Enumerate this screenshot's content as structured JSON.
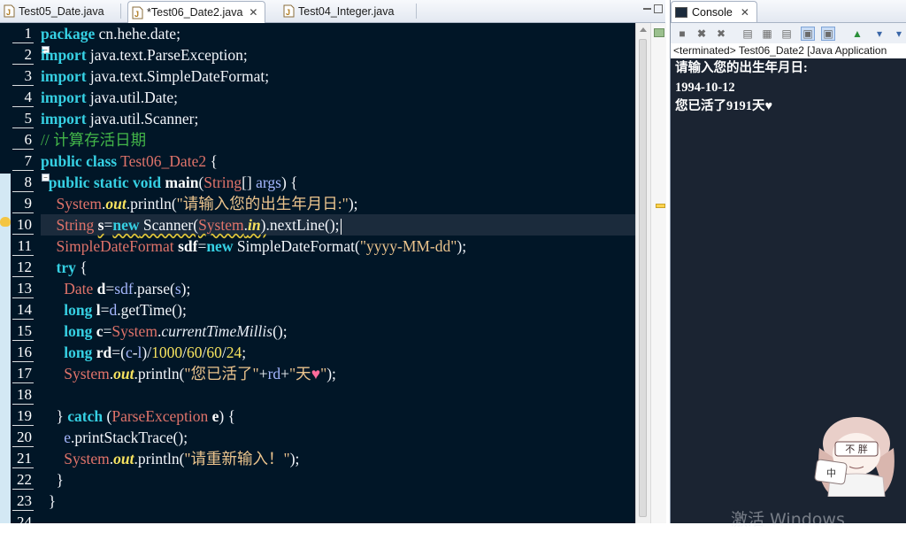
{
  "editor": {
    "tabs": [
      {
        "label": "Test05_Date.java",
        "active": false,
        "closable": false
      },
      {
        "label": "*Test06_Date2.java",
        "active": true,
        "closable": true,
        "close_glyph": "✕"
      },
      {
        "label": "Test04_Integer.java",
        "active": false,
        "closable": false
      }
    ],
    "line_numbers": [
      "1",
      "2",
      "3",
      "4",
      "5",
      "6",
      "7",
      "8",
      "9",
      "10",
      "11",
      "12",
      "13",
      "14",
      "15",
      "16",
      "17",
      "18",
      "19",
      "20",
      "21",
      "22",
      "23",
      "24"
    ],
    "code_lines": [
      [
        {
          "t": "package",
          "c": "kw"
        },
        {
          "t": " cn.hehe.date;",
          "c": "pl"
        }
      ],
      [
        {
          "t": "import",
          "c": "kw"
        },
        {
          "t": " java.text.ParseException;",
          "c": "pl"
        }
      ],
      [
        {
          "t": "import",
          "c": "kw"
        },
        {
          "t": " java.text.SimpleDateFormat;",
          "c": "pl"
        }
      ],
      [
        {
          "t": "import",
          "c": "kw"
        },
        {
          "t": " java.util.Date;",
          "c": "pl"
        }
      ],
      [
        {
          "t": "import",
          "c": "kw"
        },
        {
          "t": " java.util.Scanner;",
          "c": "pl"
        }
      ],
      [
        {
          "t": "// 计算存活日期",
          "c": "cmt"
        }
      ],
      [
        {
          "t": "public class",
          "c": "kw"
        },
        {
          "t": " ",
          "c": "pl"
        },
        {
          "t": "Test06_Date2",
          "c": "typ"
        },
        {
          "t": " {",
          "c": "pl"
        }
      ],
      [
        {
          "t": "  ",
          "c": "pl"
        },
        {
          "t": "public static void",
          "c": "kw"
        },
        {
          "t": " ",
          "c": "pl"
        },
        {
          "t": "main",
          "c": "bld"
        },
        {
          "t": "(",
          "c": "pl"
        },
        {
          "t": "String",
          "c": "typ"
        },
        {
          "t": "[] ",
          "c": "pl"
        },
        {
          "t": "args",
          "c": "var"
        },
        {
          "t": ") {",
          "c": "pl"
        }
      ],
      [
        {
          "t": "    ",
          "c": "pl"
        },
        {
          "t": "System",
          "c": "typ"
        },
        {
          "t": ".",
          "c": "pl"
        },
        {
          "t": "out",
          "c": "fld"
        },
        {
          "t": ".println(",
          "c": "pl"
        },
        {
          "t": "\"请输入您的出生年月日:\"",
          "c": "str"
        },
        {
          "t": ");",
          "c": "pl"
        }
      ],
      [
        {
          "t": "    ",
          "c": "pl"
        },
        {
          "t": "String",
          "c": "typ"
        },
        {
          "t": " ",
          "c": "pl"
        },
        {
          "t": "s",
          "c": "bld wavy"
        },
        {
          "t": "=",
          "c": "pl"
        },
        {
          "t": "new",
          "c": "kw wavy"
        },
        {
          "t": " Scanner(",
          "c": "pl wavy"
        },
        {
          "t": "System",
          "c": "typ wavy"
        },
        {
          "t": ".",
          "c": "pl wavy"
        },
        {
          "t": "in",
          "c": "fld wavy"
        },
        {
          "t": ")",
          "c": "pl wavy"
        },
        {
          "t": ".nextLine();",
          "c": "pl"
        }
      ],
      [
        {
          "t": "    ",
          "c": "pl"
        },
        {
          "t": "SimpleDateFormat",
          "c": "typ"
        },
        {
          "t": " ",
          "c": "pl"
        },
        {
          "t": "sdf",
          "c": "bld"
        },
        {
          "t": "=",
          "c": "pl"
        },
        {
          "t": "new",
          "c": "kw"
        },
        {
          "t": " SimpleDateFormat(",
          "c": "pl"
        },
        {
          "t": "\"yyyy-MM-dd\"",
          "c": "str"
        },
        {
          "t": ");",
          "c": "pl"
        }
      ],
      [
        {
          "t": "    ",
          "c": "pl"
        },
        {
          "t": "try",
          "c": "kw"
        },
        {
          "t": " {",
          "c": "pl"
        }
      ],
      [
        {
          "t": "      ",
          "c": "pl"
        },
        {
          "t": "Date",
          "c": "typ"
        },
        {
          "t": " ",
          "c": "pl"
        },
        {
          "t": "d",
          "c": "bld"
        },
        {
          "t": "=",
          "c": "pl"
        },
        {
          "t": "sdf",
          "c": "var"
        },
        {
          "t": ".parse(",
          "c": "pl"
        },
        {
          "t": "s",
          "c": "var"
        },
        {
          "t": ");",
          "c": "pl"
        }
      ],
      [
        {
          "t": "      ",
          "c": "pl"
        },
        {
          "t": "long",
          "c": "kw"
        },
        {
          "t": " ",
          "c": "pl"
        },
        {
          "t": "l",
          "c": "bld"
        },
        {
          "t": "=",
          "c": "pl"
        },
        {
          "t": "d",
          "c": "var"
        },
        {
          "t": ".getTime();",
          "c": "pl"
        }
      ],
      [
        {
          "t": "      ",
          "c": "pl"
        },
        {
          "t": "long",
          "c": "kw"
        },
        {
          "t": " ",
          "c": "pl"
        },
        {
          "t": "c",
          "c": "bld"
        },
        {
          "t": "=",
          "c": "pl"
        },
        {
          "t": "System",
          "c": "typ"
        },
        {
          "t": ".",
          "c": "pl"
        },
        {
          "t": "currentTimeMillis",
          "c": "sta"
        },
        {
          "t": "();",
          "c": "pl"
        }
      ],
      [
        {
          "t": "      ",
          "c": "pl"
        },
        {
          "t": "long",
          "c": "kw"
        },
        {
          "t": " ",
          "c": "pl"
        },
        {
          "t": "rd",
          "c": "bld"
        },
        {
          "t": "=(",
          "c": "pl"
        },
        {
          "t": "c",
          "c": "var"
        },
        {
          "t": "-",
          "c": "pl"
        },
        {
          "t": "l",
          "c": "var"
        },
        {
          "t": ")/",
          "c": "pl"
        },
        {
          "t": "1000",
          "c": "num"
        },
        {
          "t": "/",
          "c": "pl"
        },
        {
          "t": "60",
          "c": "num"
        },
        {
          "t": "/",
          "c": "pl"
        },
        {
          "t": "60",
          "c": "num"
        },
        {
          "t": "/",
          "c": "pl"
        },
        {
          "t": "24",
          "c": "num"
        },
        {
          "t": ";",
          "c": "pl"
        }
      ],
      [
        {
          "t": "      ",
          "c": "pl"
        },
        {
          "t": "System",
          "c": "typ"
        },
        {
          "t": ".",
          "c": "pl"
        },
        {
          "t": "out",
          "c": "fld"
        },
        {
          "t": ".println(",
          "c": "pl"
        },
        {
          "t": "\"您已活了\"",
          "c": "str"
        },
        {
          "t": "+",
          "c": "pl"
        },
        {
          "t": "rd",
          "c": "var"
        },
        {
          "t": "+",
          "c": "pl"
        },
        {
          "t": "\"天",
          "c": "str"
        },
        {
          "t": "♥",
          "c": "heart"
        },
        {
          "t": "\"",
          "c": "str"
        },
        {
          "t": ");",
          "c": "pl"
        }
      ],
      [],
      [
        {
          "t": "    } ",
          "c": "pl"
        },
        {
          "t": "catch",
          "c": "kw"
        },
        {
          "t": " (",
          "c": "pl"
        },
        {
          "t": "ParseException",
          "c": "typ"
        },
        {
          "t": " ",
          "c": "pl"
        },
        {
          "t": "e",
          "c": "bld"
        },
        {
          "t": ") {",
          "c": "pl"
        }
      ],
      [
        {
          "t": "      ",
          "c": "pl"
        },
        {
          "t": "e",
          "c": "var"
        },
        {
          "t": ".printStackTrace();",
          "c": "pl"
        }
      ],
      [
        {
          "t": "      ",
          "c": "pl"
        },
        {
          "t": "System",
          "c": "typ"
        },
        {
          "t": ".",
          "c": "pl"
        },
        {
          "t": "out",
          "c": "fld"
        },
        {
          "t": ".println(",
          "c": "pl"
        },
        {
          "t": "\"请重新输入！\"",
          "c": "str"
        },
        {
          "t": ");",
          "c": "pl"
        }
      ],
      [
        {
          "t": "    }",
          "c": "pl"
        }
      ],
      [
        {
          "t": "  }",
          "c": "pl"
        }
      ],
      []
    ],
    "current_line": 10,
    "fold_markers": [
      2,
      8
    ],
    "colors": {
      "background": "#011627",
      "keyword": "#36d0e3",
      "string": "#ecc48d",
      "type": "#e0736a",
      "comment": "#43b649",
      "number": "#f7e35f",
      "current_line": "#1b2b3c"
    }
  },
  "console": {
    "tab_label": "Console",
    "close_glyph": "✕",
    "toolbar_icons": [
      "terminate-icon",
      "remove-launch-icon",
      "remove-all-icon",
      "clear-console-icon",
      "scroll-lock-icon",
      "show-on-stdout-icon",
      "show-on-stderr-icon",
      "pin-console-icon",
      "display-console-icon",
      "new-console-icon"
    ],
    "status": "<terminated> Test06_Date2 [Java Application",
    "output_lines": [
      "请输入您的出生年月日:",
      "1994-10-12",
      "您已活了9191天♥"
    ],
    "watermark": "激活 Windows",
    "mascot_badge": "不 胖",
    "mascot_tag": "中"
  }
}
